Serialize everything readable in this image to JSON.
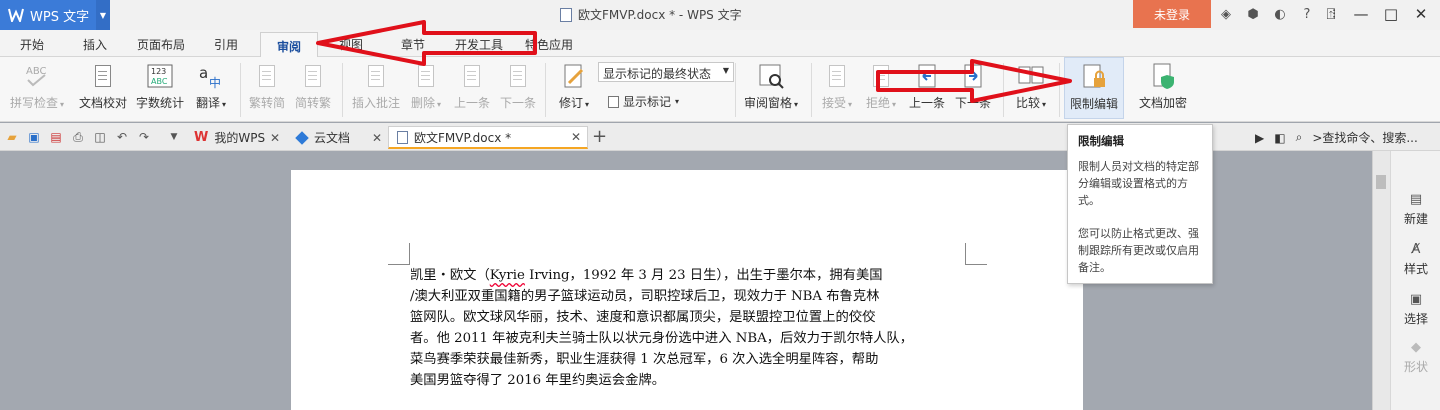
{
  "titlebar": {
    "app_name": "WPS 文字",
    "window_title": "欧文FMVP.docx * - WPS 文字",
    "login_label": "未登录",
    "icons": [
      "skin-icon",
      "cube-icon",
      "share-icon",
      "help-icon",
      "menu-icon"
    ],
    "help_text": "?"
  },
  "tabs": [
    {
      "label": "开始"
    },
    {
      "label": "插入"
    },
    {
      "label": "页面布局"
    },
    {
      "label": "引用"
    },
    {
      "label": "审阅",
      "active": true
    },
    {
      "label": "视图"
    },
    {
      "label": "章节"
    },
    {
      "label": "开发工具"
    },
    {
      "label": "特色应用"
    }
  ],
  "ribbon": {
    "spell_check": "拼写检查",
    "proofread": "文档校对",
    "word_count": "字数统计",
    "word_count_icon_text": "123 ABC",
    "translate": "翻译",
    "trad_to_simp": "繁转简",
    "simp_to_trad": "简转繁",
    "insert_comment": "插入批注",
    "delete": "删除",
    "prev": "上一条",
    "next": "下一条",
    "revise": "修订",
    "markup_mode": "显示标记的最终状态",
    "show_markup": "显示标记",
    "review_pane": "审阅窗格",
    "accept": "接受",
    "reject": "拒绝",
    "prev2": "上一条",
    "next2": "下一条",
    "compare": "比较",
    "restrict_edit": "限制编辑",
    "doc_encrypt": "文档加密"
  },
  "doc_tabs": [
    {
      "label": "我的WPS"
    },
    {
      "label": "云文档"
    },
    {
      "label": "欧文FMVP.docx *",
      "current": true
    }
  ],
  "search_placeholder": ">查找命令、搜索...",
  "document": {
    "lines": [
      [
        "凯里・欧文（",
        "Kyrie",
        " Irving，1992 年 3 月 23 日生），出生于墨尔本，拥有美国"
      ],
      "/澳大利亚双重国籍的男子篮球运动员，司职控球后卫，现效力于 NBA 布鲁克林",
      "篮网队。欧文球风华丽，技术、速度和意识都属顶尖，是联盟控卫位置上的佼佼",
      "者。他 2011 年被克利夫兰骑士队以状元身份选中进入 NBA，后效力于凯尔特人队，",
      "菜鸟赛季荣获最佳新秀，职业生涯获得 1 次总冠军，6 次入选全明星阵容，帮助",
      "美国男篮夺得了 2016 年里约奥运会金牌。"
    ]
  },
  "tooltip": {
    "title": "限制编辑",
    "para1": "限制人员对文档的特定部分编辑或设置格式的方式。",
    "para2": "您可以防止格式更改、强制跟踪所有更改或仅启用备注。"
  },
  "side_panel": [
    {
      "label": "新建",
      "icon": "new-doc-icon"
    },
    {
      "label": "样式",
      "icon": "style-icon"
    },
    {
      "label": "选择",
      "icon": "select-icon"
    },
    {
      "label": "形状",
      "icon": "shape-icon",
      "disabled": true
    }
  ],
  "colors": {
    "app_blue": "#3b7bd8",
    "login_orange": "#e8734f",
    "annotation_red": "#e0101a",
    "tab_active": "#1c4f9e"
  }
}
